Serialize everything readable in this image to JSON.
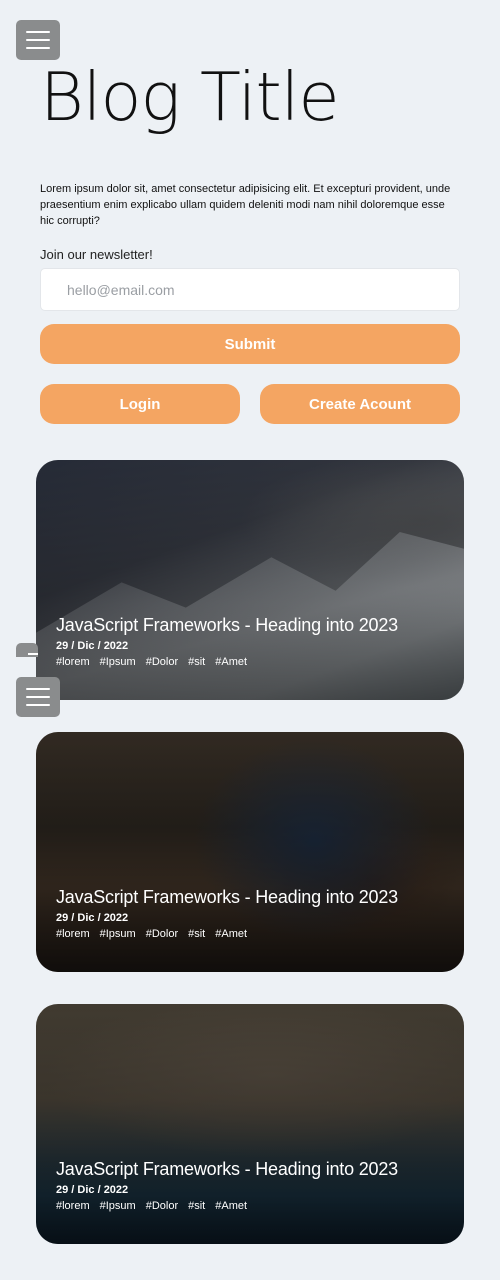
{
  "header": {
    "menu_icon": "hamburger-menu-icon",
    "title": "Blog Title",
    "intro": "Lorem ipsum dolor sit, amet consectetur adipisicing elit. Et excepturi provident, unde praesentium enim explicabo ullam quidem deleniti modi nam nihil doloremque esse hic corrupti?"
  },
  "newsletter": {
    "label": "Join our newsletter!",
    "email_value": "",
    "email_placeholder": "hello@email.com",
    "submit_label": "Submit"
  },
  "auth": {
    "login_label": "Login",
    "create_label": "Create Acount"
  },
  "colors": {
    "accent": "#f4a562",
    "background": "#edf1f5",
    "menu_button": "#8a8c8d"
  },
  "posts": [
    {
      "title": "JavaScript Frameworks - Heading into 2023",
      "date": "29 / Dic / 2022",
      "tags": [
        "#lorem",
        "#Ipsum",
        "#Dolor",
        "#sit",
        "#Amet"
      ]
    },
    {
      "title": "JavaScript Frameworks - Heading into 2023",
      "date": "29 / Dic / 2022",
      "tags": [
        "#lorem",
        "#Ipsum",
        "#Dolor",
        "#sit",
        "#Amet"
      ]
    },
    {
      "title": "JavaScript Frameworks - Heading into 2023",
      "date": "29 / Dic / 2022",
      "tags": [
        "#lorem",
        "#Ipsum",
        "#Dolor",
        "#sit",
        "#Amet"
      ]
    }
  ]
}
